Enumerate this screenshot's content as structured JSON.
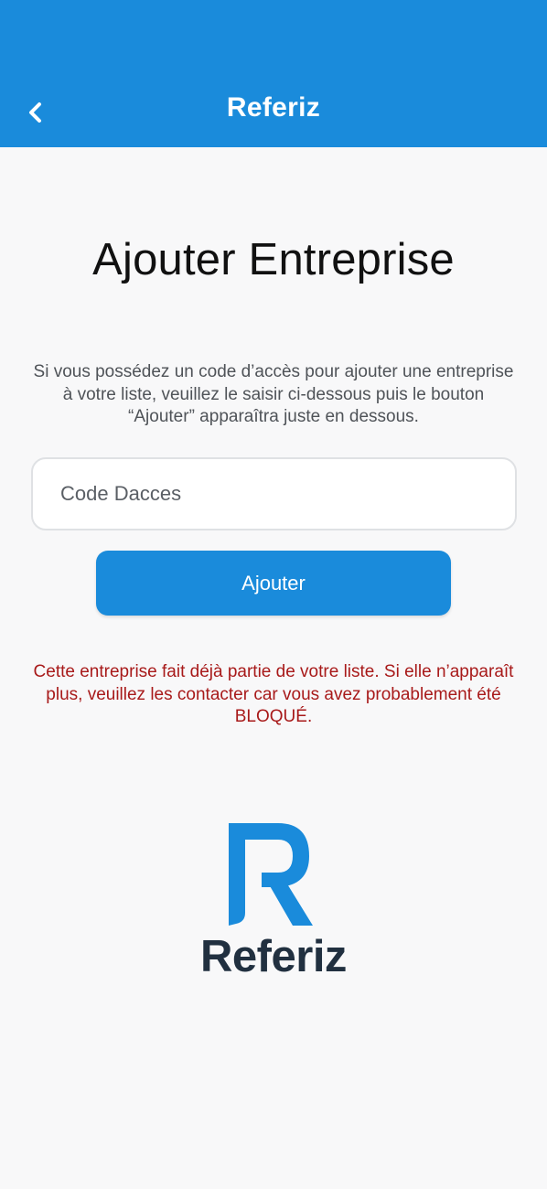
{
  "header": {
    "title": "Referiz",
    "back_icon": "chevron-left-icon",
    "background_color": "#1a8bdb"
  },
  "main": {
    "page_title": "Ajouter Entreprise",
    "description": "Si vous possédez un code d’accès pour ajouter une entreprise à votre liste, veuillez le saisir ci-dessous puis le bouton “Ajouter” apparaîtra juste en dessous.",
    "code_input": {
      "placeholder": "Code Dacces",
      "value": ""
    },
    "submit_label": "Ajouter",
    "error_message": "Cette entreprise fait déjà partie de votre liste. Si elle n’apparaît plus, veuillez les contacter car vous avez probablement été BLOQUÉ.",
    "error_color": "#a81a1a"
  },
  "logo": {
    "wordmark": "Referiz",
    "brand_color": "#1a8bdb",
    "wordmark_color": "#213040"
  }
}
